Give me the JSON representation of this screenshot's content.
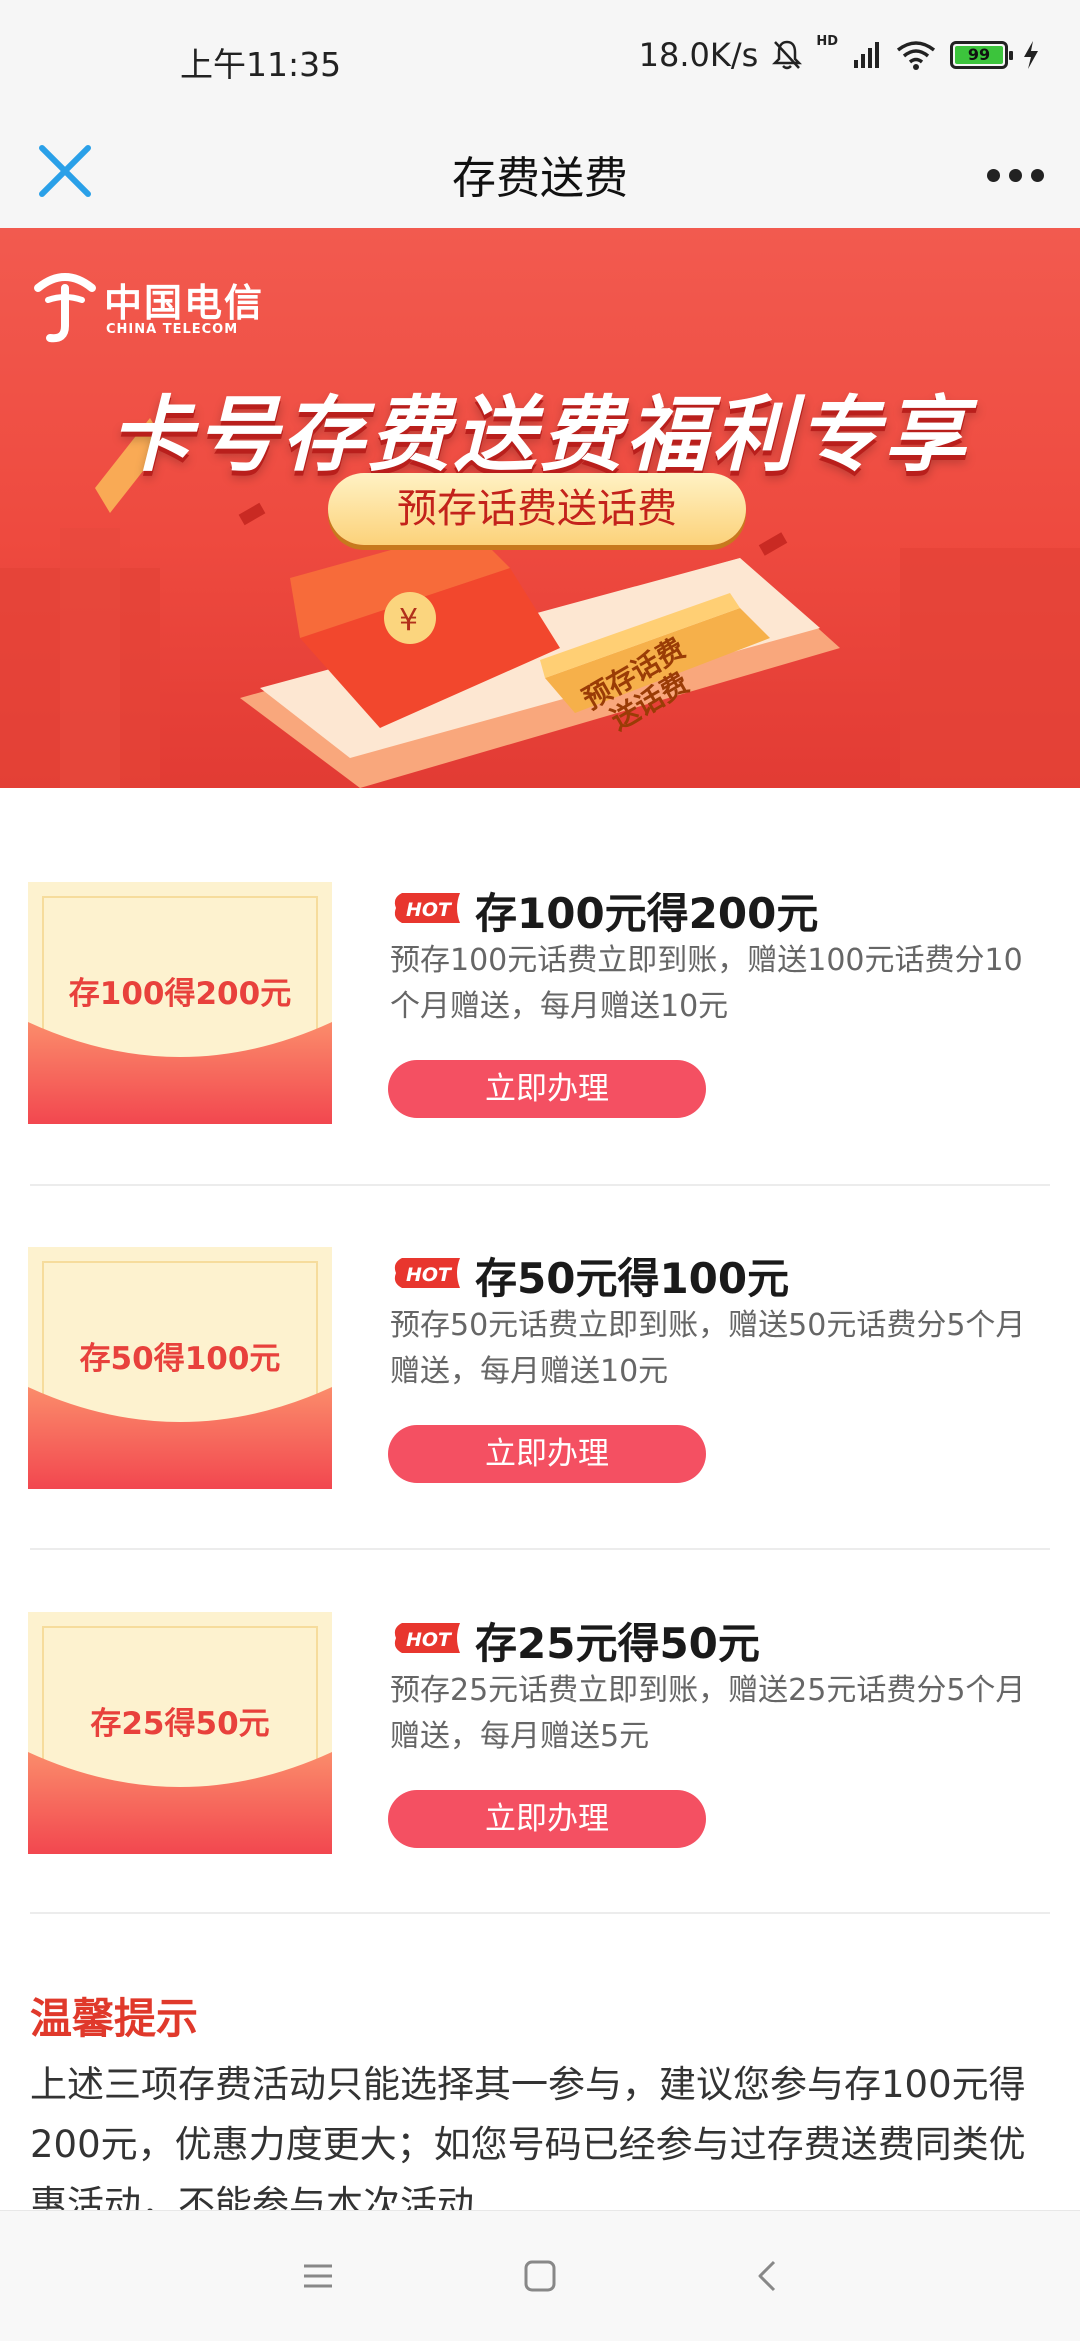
{
  "status_bar": {
    "time": "上午11:35",
    "network_speed": "18.0K/s",
    "hd_label": "HD",
    "battery": "99",
    "icons": [
      "mute-bell-icon",
      "signal-icon",
      "wifi-icon",
      "battery-icon",
      "charging-icon"
    ]
  },
  "nav": {
    "title": "存费送费",
    "close_icon": "close-icon",
    "more_icon": "more-icon"
  },
  "banner": {
    "brand_cn": "中国电信",
    "brand_en": "CHINA TELECOM",
    "headline": "卡号存费送费福利专享",
    "pill": "预存话费送话费",
    "stamp": "预存话费\n送话费"
  },
  "offers": [
    {
      "thumb": "存100得200元",
      "badge": "HOT",
      "title": "存100元得200元",
      "desc": "预存100元话费立即到账，赠送100元话费分10个月赠送，每月赠送10元",
      "button": "立即办理"
    },
    {
      "thumb": "存50得100元",
      "badge": "HOT",
      "title": "存50元得100元",
      "desc": "预存50元话费立即到账，赠送50元话费分5个月赠送，每月赠送10元",
      "button": "立即办理"
    },
    {
      "thumb": "存25得50元",
      "badge": "HOT",
      "title": "存25元得50元",
      "desc": "预存25元话费立即到账，赠送25元话费分5个月赠送，每月赠送5元",
      "button": "立即办理"
    }
  ],
  "tips": {
    "title": "温馨提示",
    "body": "上述三项存费活动只能选择其一参与，建议您参与存100元得200元，优惠力度更大；如您号码已经参与过存费送费同类优惠活动，不能参与本次活动"
  },
  "system_nav": {
    "icons": [
      "menu-icon",
      "home-square-icon",
      "back-icon"
    ]
  },
  "colors": {
    "accent_red": "#f45062",
    "banner_red": "#ee4a3f",
    "tips_red": "#e0392b"
  }
}
